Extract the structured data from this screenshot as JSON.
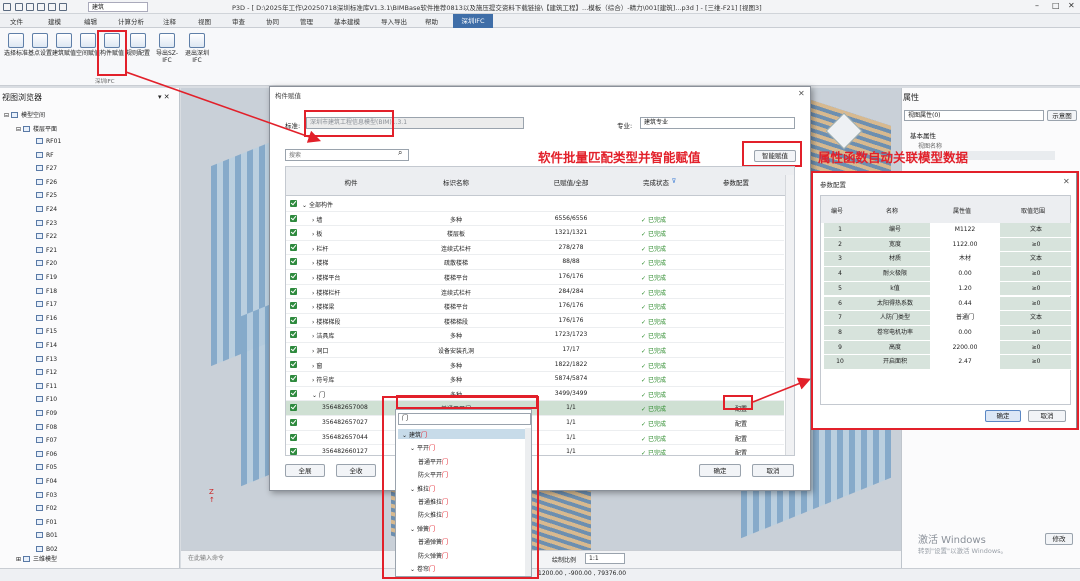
{
  "app": {
    "title": "P3D - [ D:\\2025年工作\\20250718深圳标准库V1.3.1\\BIMBase软件推荐0813以及施压提交资料下载链接\\【建筑工程】...模板（综合）-精力\\001[建筑]...p3d ] - [三维-F21] [视图3]",
    "project_selector": "建筑"
  },
  "menu": {
    "items": [
      "文件",
      "建模",
      "编辑",
      "计算分析",
      "注释",
      "视图",
      "审查",
      "协同",
      "管理",
      "基本建模",
      "导入导出",
      "帮助"
    ],
    "active": "深圳IFC"
  },
  "ribbon": {
    "buttons": [
      "选择标准",
      "基点设置",
      "建筑赋值",
      "空间赋值",
      "构件赋值",
      "规则配置",
      "导出SZ-IFC",
      "退出深圳IFC"
    ],
    "group_label": "深圳IFC"
  },
  "left_panel": {
    "title": "视图浏览器",
    "tree_root": "模型空间",
    "tree_group": "楼层平面",
    "floors": [
      "RF01",
      "RF",
      "F27",
      "F26",
      "F25",
      "F24",
      "F23",
      "F22",
      "F21",
      "F20",
      "F19",
      "F18",
      "F17",
      "F16",
      "F15",
      "F14",
      "F13",
      "F12",
      "F11",
      "F10",
      "F09",
      "F08",
      "F07",
      "F06",
      "F05",
      "F04",
      "F03",
      "F02",
      "F01",
      "B01",
      "B02"
    ],
    "tree_bottom": "三维模型"
  },
  "right_panel": {
    "title": "属性",
    "view_prop": "视图属性(0)",
    "show_btn": "示意图",
    "section": "基本属性",
    "field": "视图名称"
  },
  "main_dialog": {
    "title": "构件赋值",
    "standard_label": "标准:",
    "standard_value": "深圳市建筑工程信息模型(BIM)1.3.1",
    "specialty_label": "专业:",
    "specialty_value": "建筑专业",
    "search_placeholder": "搜索",
    "smart_btn": "智能赋值",
    "headers": [
      "构件",
      "标识名称",
      "已赋值/全部",
      "完成状态",
      "参数配置"
    ],
    "rows": [
      {
        "name": "全部构件",
        "ident": "",
        "count": "",
        "status": "",
        "param": ""
      },
      {
        "name": "墙",
        "ident": "多种",
        "count": "6556/6556",
        "status": "已完成",
        "param": ""
      },
      {
        "name": "板",
        "ident": "楼层板",
        "count": "1321/1321",
        "status": "已完成",
        "param": ""
      },
      {
        "name": "栏杆",
        "ident": "连续式栏杆",
        "count": "278/278",
        "status": "已完成",
        "param": ""
      },
      {
        "name": "楼梯",
        "ident": "疏散楼梯",
        "count": "88/88",
        "status": "已完成",
        "param": ""
      },
      {
        "name": "楼梯平台",
        "ident": "楼梯平台",
        "count": "176/176",
        "status": "已完成",
        "param": ""
      },
      {
        "name": "楼梯栏杆",
        "ident": "连续式栏杆",
        "count": "284/284",
        "status": "已完成",
        "param": ""
      },
      {
        "name": "楼梯梁",
        "ident": "楼梯平台",
        "count": "176/176",
        "status": "已完成",
        "param": ""
      },
      {
        "name": "楼梯梯段",
        "ident": "楼梯梯段",
        "count": "176/176",
        "status": "已完成",
        "param": ""
      },
      {
        "name": "洁具库",
        "ident": "多种",
        "count": "1723/1723",
        "status": "已完成",
        "param": ""
      },
      {
        "name": "洞口",
        "ident": "设备安装孔洞",
        "count": "17/17",
        "status": "已完成",
        "param": ""
      },
      {
        "name": "窗",
        "ident": "多种",
        "count": "1822/1822",
        "status": "已完成",
        "param": ""
      },
      {
        "name": "符号库",
        "ident": "多种",
        "count": "5874/5874",
        "status": "已完成",
        "param": ""
      },
      {
        "name": "门",
        "ident": "多种",
        "count": "3499/3499",
        "status": "已完成",
        "param": ""
      },
      {
        "name": "356482657008",
        "ident": "普通平开门",
        "count": "1/1",
        "status": "已完成",
        "param": "配置"
      },
      {
        "name": "356482657027",
        "ident": "",
        "count": "1/1",
        "status": "已完成",
        "param": "配置"
      },
      {
        "name": "356482657044",
        "ident": "",
        "count": "1/1",
        "status": "已完成",
        "param": "配置"
      },
      {
        "name": "356482660127",
        "ident": "",
        "count": "1/1",
        "status": "已完成",
        "param": "配置"
      }
    ],
    "btn_expand": "全展",
    "btn_collapse": "全收",
    "btn_ok": "确定",
    "btn_cancel": "取消"
  },
  "dropdown": {
    "filter": "门",
    "items": [
      {
        "prefix": "建筑",
        "hl": "门",
        "indent": 0
      },
      {
        "prefix": "平开",
        "hl": "门",
        "indent": 1
      },
      {
        "prefix": "普通平开",
        "hl": "门",
        "indent": 2
      },
      {
        "prefix": "防火平开",
        "hl": "门",
        "indent": 2
      },
      {
        "prefix": "推拉",
        "hl": "门",
        "indent": 1
      },
      {
        "prefix": "普通推拉",
        "hl": "门",
        "indent": 2
      },
      {
        "prefix": "防火推拉",
        "hl": "门",
        "indent": 2
      },
      {
        "prefix": "弹簧",
        "hl": "门",
        "indent": 1
      },
      {
        "prefix": "普通弹簧",
        "hl": "门",
        "indent": 2
      },
      {
        "prefix": "防火弹簧",
        "hl": "门",
        "indent": 2
      },
      {
        "prefix": "卷帘",
        "hl": "门",
        "indent": 1
      }
    ]
  },
  "annotations": {
    "left": "软件批量匹配类型并智能赋值",
    "right": "属性函数自动关联模型数据"
  },
  "param_dialog": {
    "title": "参数配置",
    "headers": [
      "编号",
      "名称",
      "属性值",
      "取值范围"
    ],
    "rows": [
      [
        "1",
        "编号",
        "M1122",
        "文本"
      ],
      [
        "2",
        "宽度",
        "1122.00",
        "≥0"
      ],
      [
        "3",
        "材质",
        "木材",
        "文本"
      ],
      [
        "4",
        "耐火极限",
        "0.00",
        "≥0"
      ],
      [
        "5",
        "k值",
        "1.20",
        "≥0"
      ],
      [
        "6",
        "太阳得热系数",
        "0.44",
        "≥0"
      ],
      [
        "7",
        "人防门类型",
        "普通门",
        "文本"
      ],
      [
        "8",
        "卷帘电机功率",
        "0.00",
        "≥0"
      ],
      [
        "9",
        "高度",
        "2200.00",
        "≥0"
      ],
      [
        "10",
        "开启面积",
        "2.47",
        "≥0"
      ]
    ],
    "btn_ok": "确定",
    "btn_cancel": "取消"
  },
  "bottom": {
    "command_placeholder": "在此输入命令",
    "scale_label": "绘制比例",
    "scale_value": "1:1",
    "coords": "1200.00 , -900.00 , 79376.00",
    "modify_btn": "修改"
  },
  "watermark": {
    "line1": "激活 Windows",
    "line2": "转到\"设置\"以激活 Windows。"
  }
}
